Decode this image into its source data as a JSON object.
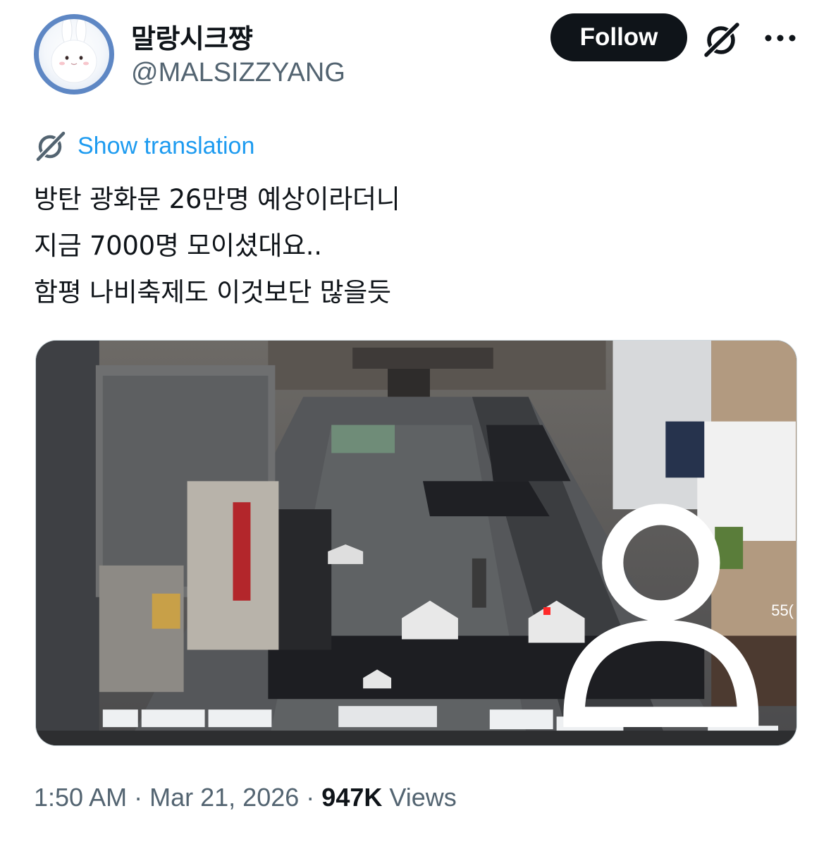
{
  "author": {
    "display_name": "말랑시크쨩",
    "handle": "@MALSIZZYANG"
  },
  "actions": {
    "follow_label": "Follow",
    "grok_icon": "grok-icon",
    "more_icon": "more-options-icon"
  },
  "translation": {
    "label": "Show translation",
    "icon": "translate-icon"
  },
  "tweet": {
    "lines": [
      "방탄 광화문 26만명 예상이라더니",
      "지금 7000명 모이셨대요..",
      "함평 나비축제도 이것보단 많을듯"
    ]
  },
  "media": {
    "overlay_viewers": "55("
  },
  "meta": {
    "time": "1:50 AM",
    "separator": "·",
    "date": "Mar 21, 2026",
    "views_count": "947K",
    "views_label": "Views"
  },
  "colors": {
    "link": "#1d9bf0",
    "text": "#0f1419",
    "secondary": "#536471",
    "follow_bg": "#0f1419"
  }
}
